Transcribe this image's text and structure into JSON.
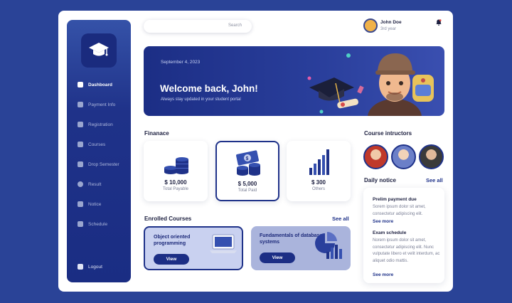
{
  "sidebar": {
    "logo_icon": "graduation-cap-icon",
    "items": [
      {
        "label": "Dashboard",
        "icon": "dashboard-icon",
        "active": true
      },
      {
        "label": "Payment Info",
        "icon": "payment-icon"
      },
      {
        "label": "Registration",
        "icon": "pencil-icon"
      },
      {
        "label": "Courses",
        "icon": "book-icon"
      },
      {
        "label": "Drop Semester",
        "icon": "document-icon"
      },
      {
        "label": "Result",
        "icon": "result-icon"
      },
      {
        "label": "Notice",
        "icon": "chat-icon"
      },
      {
        "label": "Schedule",
        "icon": "calendar-icon"
      }
    ],
    "logout": {
      "label": "Logout",
      "icon": "logout-icon"
    }
  },
  "header": {
    "search_placeholder": "Search",
    "user_name": "John Doe",
    "user_year": "3rd year"
  },
  "banner": {
    "date": "September 4, 2023",
    "welcome": "Welcome back, John!",
    "subtitle": "Always stay updated in your student portal"
  },
  "finance": {
    "title": "Finanace",
    "cards": [
      {
        "amount": "$ 10,000",
        "caption": "Total Payable"
      },
      {
        "amount": "$ 5,000",
        "caption": "Total Paid"
      },
      {
        "amount": "$ 300",
        "caption": "Others"
      }
    ]
  },
  "enrolled": {
    "title": "Enrolled Courses",
    "see_all": "See all",
    "courses": [
      {
        "name": "Object oriented programming",
        "view": "View"
      },
      {
        "name": "Fundamentals of database systems",
        "view": "View"
      }
    ]
  },
  "instructors": {
    "title": "Course intructors"
  },
  "notice": {
    "title": "Daily notice",
    "see_all": "See all",
    "items": [
      {
        "title": "Prelim payment due",
        "body": "Sorem ipsum dolor sit amet, consectetur adipiscing elit.",
        "more": "See more"
      },
      {
        "title": "Exam schedule",
        "body": "Norem ipsum dolor sit amet, consectetur adipiscing elit. Nunc vulputate libero et velit interdum, ac aliquet odio mattis.",
        "more": "See more"
      }
    ]
  },
  "colors": {
    "background": "#2a4397",
    "primary": "#1f3289",
    "card_light": "#c9d1f0",
    "card_muted": "#aab4dc"
  }
}
